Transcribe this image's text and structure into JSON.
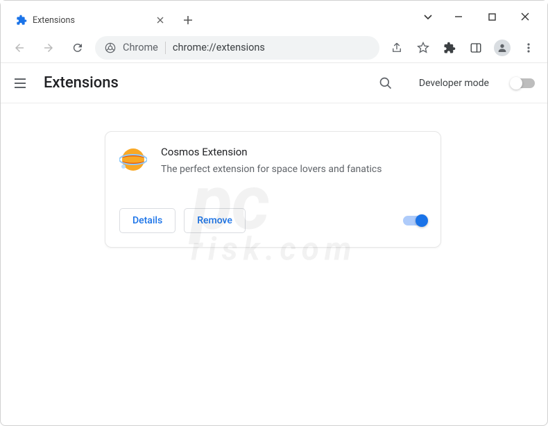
{
  "window": {
    "tab_title": "Extensions"
  },
  "omnibox": {
    "prefix": "Chrome",
    "path": "chrome://extensions"
  },
  "header": {
    "title": "Extensions",
    "developer_mode_label": "Developer mode",
    "developer_mode_on": false
  },
  "extension": {
    "name": "Cosmos Extension",
    "description": "The perfect extension for space lovers and fanatics",
    "details_label": "Details",
    "remove_label": "Remove",
    "enabled": true
  },
  "watermark": {
    "line1": "pc",
    "line2": "risk.com"
  }
}
